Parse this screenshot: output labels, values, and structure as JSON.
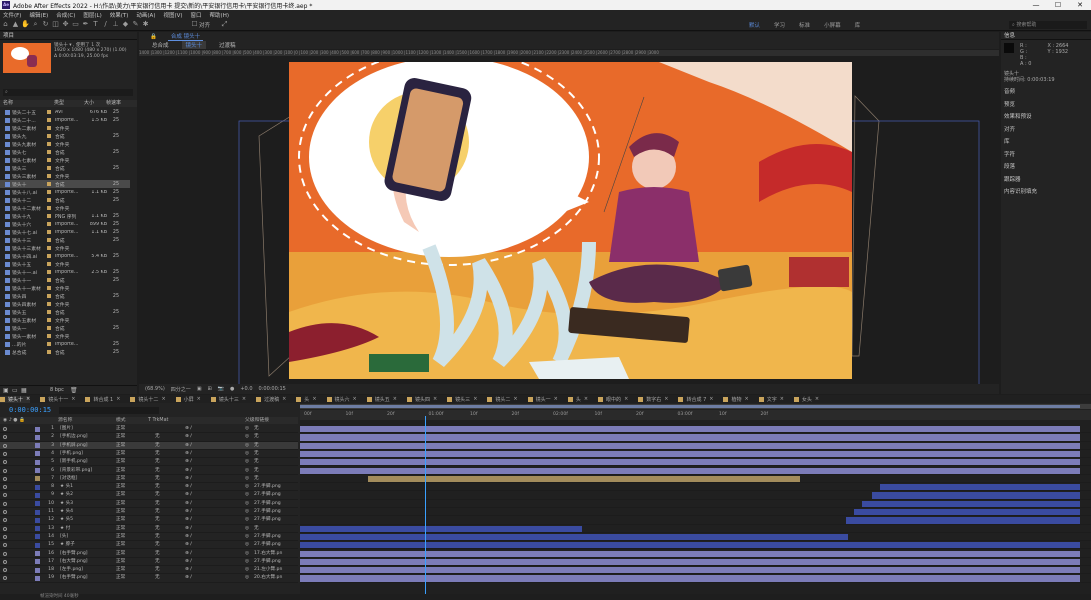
{
  "window": {
    "app_icon": "Ae",
    "title": "Adobe After Effects 2022 - H:\\作品\\美力\\平安银行信用卡 提交\\新的\\平安银行信用卡\\平安银行信用卡终.aep *",
    "minimize": "—",
    "maximize": "☐",
    "close": "✕"
  },
  "menu": [
    "文件(F)",
    "编辑(E)",
    "合成(C)",
    "图层(L)",
    "效果(T)",
    "动画(A)",
    "视图(V)",
    "窗口",
    "帮助(H)"
  ],
  "toolbar": {
    "snap_label": "对齐",
    "workspaces": [
      "默认",
      "学习",
      "标准",
      "小屏幕",
      "库"
    ],
    "active_workspace": "默认",
    "search_help": "搜索帮助"
  },
  "project": {
    "title": "项目",
    "item_name": "镜头十",
    "item_meta": "▾ , 使用了 1 次",
    "item_size": "1920 x 1080 (480 x 270) (1.00)",
    "item_duration": "Δ 0:00:03:19, 25.00 fps",
    "search_placeholder": "⌕",
    "columns": [
      "名称",
      "类型",
      "大小",
      "帧速率"
    ],
    "rows": [
      {
        "name": "镜头二十五",
        "type": "AVI",
        "size": "676 KB",
        "fps": "25",
        "color": "#c9a45c"
      },
      {
        "name": "镜头二十...",
        "type": "Importe...",
        "size": "1.5 KB",
        "fps": "25",
        "color": "#c9a45c"
      },
      {
        "name": "镜头二素材",
        "type": "文件夹",
        "size": "",
        "fps": "",
        "color": "#c9a45c"
      },
      {
        "name": "镜头九",
        "type": "合成",
        "size": "",
        "fps": "25",
        "color": "#c9a45c"
      },
      {
        "name": "镜头九素材",
        "type": "文件夹",
        "size": "",
        "fps": "",
        "color": "#c9a45c"
      },
      {
        "name": "镜头七",
        "type": "合成",
        "size": "",
        "fps": "25",
        "color": "#c9a45c"
      },
      {
        "name": "镜头七素材",
        "type": "文件夹",
        "size": "",
        "fps": "",
        "color": "#c9a45c"
      },
      {
        "name": "镜头三",
        "type": "合成",
        "size": "",
        "fps": "25",
        "color": "#c9a45c"
      },
      {
        "name": "镜头三素材",
        "type": "文件夹",
        "size": "",
        "fps": "",
        "color": "#c9a45c"
      },
      {
        "name": "镜头十",
        "type": "合成",
        "size": "",
        "fps": "25",
        "color": "#c9a45c"
      },
      {
        "name": "镜头十八.ai",
        "type": "Importe...",
        "size": "1.1 KB",
        "fps": "25",
        "color": "#c9a45c"
      },
      {
        "name": "镜头十二",
        "type": "合成",
        "size": "",
        "fps": "25",
        "color": "#c9a45c"
      },
      {
        "name": "镜头十二素材",
        "type": "文件夹",
        "size": "",
        "fps": "",
        "color": "#c9a45c"
      },
      {
        "name": "镜头十九",
        "type": "PNG 序列",
        "size": "1.1 KB",
        "fps": "25",
        "color": "#c9a45c"
      },
      {
        "name": "镜头十六",
        "type": "Importe...",
        "size": "899 KB",
        "fps": "25",
        "color": "#c9a45c"
      },
      {
        "name": "镜头十七.ai",
        "type": "Importe...",
        "size": "1.1 KB",
        "fps": "25",
        "color": "#c9a45c"
      },
      {
        "name": "镜头十三",
        "type": "合成",
        "size": "",
        "fps": "25",
        "color": "#c9a45c"
      },
      {
        "name": "镜头十三素材",
        "type": "文件夹",
        "size": "",
        "fps": "",
        "color": "#c9a45c"
      },
      {
        "name": "镜头十四.ai",
        "type": "Importe...",
        "size": "5.4 KB",
        "fps": "25",
        "color": "#c9a45c"
      },
      {
        "name": "镜头十五",
        "type": "文件夹",
        "size": "",
        "fps": "",
        "color": "#c9a45c"
      },
      {
        "name": "镜头十一.ai",
        "type": "Importe...",
        "size": "2.5 KB",
        "fps": "25",
        "color": "#c9a45c"
      },
      {
        "name": "镜头十一",
        "type": "合成",
        "size": "",
        "fps": "25",
        "color": "#c9a45c"
      },
      {
        "name": "镜头十一素材",
        "type": "文件夹",
        "size": "",
        "fps": "",
        "color": "#c9a45c"
      },
      {
        "name": "镜头四",
        "type": "合成",
        "size": "",
        "fps": "25",
        "color": "#c9a45c"
      },
      {
        "name": "镜头四素材",
        "type": "文件夹",
        "size": "",
        "fps": "",
        "color": "#c9a45c"
      },
      {
        "name": "镜头五",
        "type": "合成",
        "size": "",
        "fps": "25",
        "color": "#c9a45c"
      },
      {
        "name": "镜头五素材",
        "type": "文件夹",
        "size": "",
        "fps": "",
        "color": "#c9a45c"
      },
      {
        "name": "镜头一",
        "type": "合成",
        "size": "",
        "fps": "25",
        "color": "#c9a45c"
      },
      {
        "name": "镜头一素材",
        "type": "文件夹",
        "size": "",
        "fps": "",
        "color": "#c9a45c"
      },
      {
        "name": "…的片",
        "type": "Importe...",
        "size": "",
        "fps": "25",
        "color": "#c9a45c"
      },
      {
        "name": "总合成",
        "type": "合成",
        "size": "",
        "fps": "25",
        "color": "#c9a45c"
      }
    ],
    "selected_index": 9,
    "bpc": "8 bpc"
  },
  "composition": {
    "tab_label": "合成",
    "comp_name": "镜头十",
    "breadcrumbs": [
      "总合成",
      "镜头十",
      "过渡稿"
    ],
    "active_crumb": "镜头十",
    "ruler_text": "1400 |1300 |1200 |1100 |1000 |900 |800 |700 |600 |500 |400 |300 |200 |100 |0 |100 |200 |300 |400 |500 |600 |700 |800 |900 |1000 |1100 |1200 |1300 |1400 |1500 |1600 |1700 |1800 |1900 |2000 |2100 |2200 |2300 |2400 |2500 |2600 |2700 |2800 |2900 |3000",
    "zoom": "(68.9%)",
    "resolution": "四分之一",
    "exposure": "+0.0",
    "timecode": "0:00:00:15",
    "canvas_bg": "#e86a2a"
  },
  "info_panel": {
    "title": "信息",
    "r": "R :",
    "g": "G :",
    "b": "B :",
    "a": "A : 0",
    "x": "X : 2664",
    "y": "Y : 1932",
    "layer_name": "镜头十",
    "duration": "持续时间: 0:00:03:19",
    "panels": [
      "音频",
      "预览",
      "效果和预设",
      "对齐",
      "库",
      "字符",
      "段落",
      "跟踪器",
      "内容识别填充"
    ]
  },
  "timeline": {
    "tabs": [
      {
        "label": "镜头十",
        "color": "#c9a45c",
        "active": true
      },
      {
        "label": "镜头十一",
        "color": "#c9a45c"
      },
      {
        "label": "转合成 1",
        "color": "#c9a45c"
      },
      {
        "label": "镜头十二",
        "color": "#c9a45c"
      },
      {
        "label": "小屏",
        "color": "#c9a45c"
      },
      {
        "label": "镜头十三",
        "color": "#c9a45c"
      },
      {
        "label": "过渡稿",
        "color": "#c9a45c"
      },
      {
        "label": "头",
        "color": "#c9a45c"
      },
      {
        "label": "镜头六",
        "color": "#c9a45c"
      },
      {
        "label": "镜头五",
        "color": "#c9a45c"
      },
      {
        "label": "镜头四",
        "color": "#c9a45c"
      },
      {
        "label": "镜头三",
        "color": "#c9a45c"
      },
      {
        "label": "镜头二",
        "color": "#c9a45c"
      },
      {
        "label": "镜头一",
        "color": "#c9a45c"
      },
      {
        "label": "头",
        "color": "#c9a45c"
      },
      {
        "label": "眼中的",
        "color": "#c9a45c"
      },
      {
        "label": "数字右",
        "color": "#c9a45c"
      },
      {
        "label": "转合成 7",
        "color": "#c9a45c"
      },
      {
        "label": "植物",
        "color": "#c9a45c"
      },
      {
        "label": "文字",
        "color": "#c9a45c"
      },
      {
        "label": "女头",
        "color": "#c9a45c"
      }
    ],
    "current_time": "0:00:00:15",
    "columns": {
      "name": "源名称",
      "mode": "模式",
      "trkmat": "T TrkMat",
      "parent": "父级和链接"
    },
    "ruler": [
      "00f",
      "10f",
      "20f",
      "01:00f",
      "10f",
      "20f",
      "02:00f",
      "10f",
      "20f",
      "03:00f",
      "10f",
      "20f"
    ],
    "layers": [
      {
        "num": "1",
        "name": "[图片]",
        "mode": "正常",
        "trk": "",
        "parent": "无",
        "color": "#7c7cb8"
      },
      {
        "num": "2",
        "name": "[手机边.png]",
        "mode": "正常",
        "trk": "无",
        "parent": "无",
        "color": "#7c7cb8"
      },
      {
        "num": "3",
        "name": "[手机屏.png]",
        "mode": "正常",
        "trk": "无",
        "parent": "无",
        "color": "#7c7cb8"
      },
      {
        "num": "4",
        "name": "[手机.png]",
        "mode": "正常",
        "trk": "无",
        "parent": "无",
        "color": "#7c7cb8"
      },
      {
        "num": "5",
        "name": "[新手机.png]",
        "mode": "正常",
        "trk": "无",
        "parent": "无",
        "color": "#7c7cb8"
      },
      {
        "num": "6",
        "name": "[背景彩带.png]",
        "mode": "正常",
        "trk": "无",
        "parent": "无",
        "color": "#7c7cb8"
      },
      {
        "num": "7",
        "name": "[对话框]",
        "mode": "正常",
        "trk": "无",
        "parent": "无",
        "color": "#a38c5c"
      },
      {
        "num": "8",
        "name": "★ 头1",
        "mode": "正常",
        "trk": "无",
        "parent": "27.手脚.png",
        "color": "#3a4ba0"
      },
      {
        "num": "9",
        "name": "★ 头2",
        "mode": "正常",
        "trk": "无",
        "parent": "27.手脚.png",
        "color": "#3a4ba0"
      },
      {
        "num": "10",
        "name": "★ 头3",
        "mode": "正常",
        "trk": "无",
        "parent": "27.手脚.png",
        "color": "#3a4ba0"
      },
      {
        "num": "11",
        "name": "★ 头4",
        "mode": "正常",
        "trk": "无",
        "parent": "27.手脚.png",
        "color": "#3a4ba0"
      },
      {
        "num": "12",
        "name": "★ 头5",
        "mode": "正常",
        "trk": "无",
        "parent": "27.手脚.png",
        "color": "#3a4ba0"
      },
      {
        "num": "13",
        "name": "★ 付",
        "mode": "正常",
        "trk": "无",
        "parent": "无",
        "color": "#3a4ba0"
      },
      {
        "num": "14",
        "name": "[头]",
        "mode": "正常",
        "trk": "无",
        "parent": "27.手脚.png",
        "color": "#3a4ba0"
      },
      {
        "num": "15",
        "name": "★ 脖子",
        "mode": "正常",
        "trk": "无",
        "parent": "27.手脚.png",
        "color": "#3a4ba0"
      },
      {
        "num": "16",
        "name": "[右手臂.png]",
        "mode": "正常",
        "trk": "无",
        "parent": "17.右大臂.pn",
        "color": "#7c7cb8"
      },
      {
        "num": "17",
        "name": "[右大臂.png]",
        "mode": "正常",
        "trk": "无",
        "parent": "27.手脚.png",
        "color": "#7c7cb8"
      },
      {
        "num": "18",
        "name": "[左手.png]",
        "mode": "正常",
        "trk": "无",
        "parent": "21.左小臂.pn",
        "color": "#7c7cb8"
      },
      {
        "num": "19",
        "name": "[右手臂.png]",
        "mode": "正常",
        "trk": "无",
        "parent": "20.右大臂.pn",
        "color": "#7c7cb8"
      }
    ],
    "selected_layer_index": 2,
    "status": "帧渲染时间 40毫秒"
  }
}
